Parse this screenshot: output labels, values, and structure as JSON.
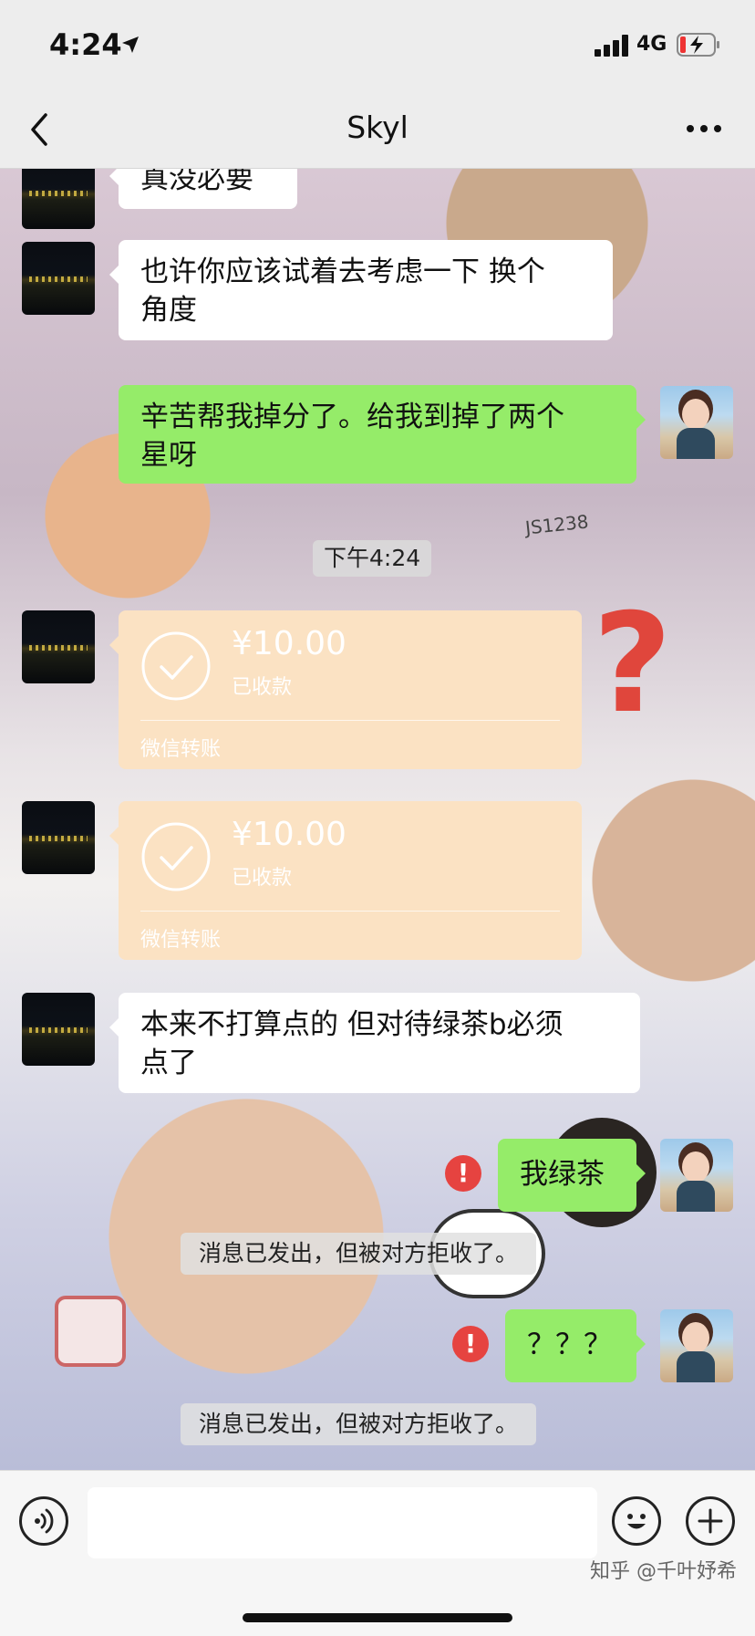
{
  "status_bar": {
    "time": "4:24",
    "network": "4G",
    "icons": [
      "location-arrow-icon",
      "signal-icon",
      "battery-charging-icon"
    ]
  },
  "nav": {
    "title": "Skyl",
    "back_icon": "chevron-left-icon",
    "more_icon": "more-dots-icon"
  },
  "messages": [
    {
      "type": "text",
      "direction": "in",
      "text": "真没必要"
    },
    {
      "type": "text",
      "direction": "in",
      "lines": [
        "也许你应该试着去考虑一下 换个",
        "角度"
      ]
    },
    {
      "type": "text",
      "direction": "out",
      "lines": [
        "辛苦帮我掉分了。给我到掉了两个",
        "星呀"
      ]
    },
    {
      "type": "time",
      "text": "下午4:24"
    },
    {
      "type": "transfer",
      "direction": "in",
      "amount": "¥10.00",
      "status": "已收款",
      "label": "微信转账"
    },
    {
      "type": "transfer",
      "direction": "in",
      "amount": "¥10.00",
      "status": "已收款",
      "label": "微信转账"
    },
    {
      "type": "text",
      "direction": "in",
      "lines": [
        "本来不打算点的 但对待绿茶b必须",
        "点了"
      ]
    },
    {
      "type": "text",
      "direction": "out",
      "text": "我绿茶",
      "error": "!"
    },
    {
      "type": "system",
      "text": "消息已发出，但被对方拒收了。"
    },
    {
      "type": "text",
      "direction": "out",
      "text": "？？？",
      "error": "!"
    },
    {
      "type": "system",
      "text": "消息已发出，但被对方拒收了。"
    }
  ],
  "wallpaper": {
    "question_mark": "?",
    "tag_text": "JS1238"
  },
  "input_bar": {
    "voice_icon": "voice-icon",
    "emoji_icon": "emoji-icon",
    "plus_icon": "plus-icon",
    "text_value": ""
  },
  "watermark": "知乎 @千叶妤希",
  "colors": {
    "outgoing_bubble": "#95ec69",
    "incoming_bubble": "#ffffff",
    "transfer_card": "#fbe2c3",
    "error_badge": "#e64340"
  }
}
